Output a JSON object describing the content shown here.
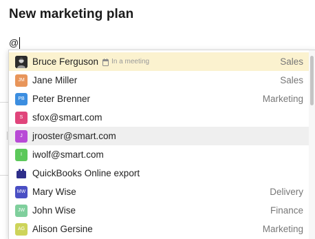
{
  "page": {
    "title": "New marketing plan"
  },
  "editor": {
    "typed_text": "@"
  },
  "mention_list": {
    "items": [
      {
        "name": "Bruce Ferguson",
        "avatar_type": "photo",
        "initials": "",
        "avatar_color": "#2b2b2b",
        "status": "In a meeting",
        "status_icon": "calendar-icon",
        "department": "Sales",
        "state": "highlighted"
      },
      {
        "name": "Jane Miller",
        "avatar_type": "initials",
        "initials": "JM",
        "avatar_color": "#e8955a",
        "status": "",
        "department": "Sales",
        "state": ""
      },
      {
        "name": "Peter Brenner",
        "avatar_type": "initials",
        "initials": "PB",
        "avatar_color": "#3c8ee0",
        "status": "",
        "department": "Marketing",
        "state": ""
      },
      {
        "name": "sfox@smart.com",
        "avatar_type": "initials",
        "initials": "S",
        "avatar_color": "#e0457b",
        "status": "",
        "department": "",
        "state": ""
      },
      {
        "name": "jrooster@smart.com",
        "avatar_type": "initials",
        "initials": "J",
        "avatar_color": "#b84ad6",
        "status": "",
        "department": "",
        "state": "hovered"
      },
      {
        "name": "iwolf@smart.com",
        "avatar_type": "initials",
        "initials": "I",
        "avatar_color": "#5cc85a",
        "status": "",
        "department": "",
        "state": ""
      },
      {
        "name": "QuickBooks Online export",
        "avatar_type": "integration",
        "initials": "",
        "avatar_color": "#2e2f8a",
        "status": "",
        "department": "",
        "state": ""
      },
      {
        "name": "Mary Wise",
        "avatar_type": "initials",
        "initials": "MW",
        "avatar_color": "#4a4fc4",
        "status": "",
        "department": "Delivery",
        "state": ""
      },
      {
        "name": "John Wise",
        "avatar_type": "initials",
        "initials": "JW",
        "avatar_color": "#7fcf9c",
        "status": "",
        "department": "Finance",
        "state": ""
      },
      {
        "name": "Alison Gersine",
        "avatar_type": "initials",
        "initials": "AG",
        "avatar_color": "#cdd45a",
        "status": "",
        "department": "Marketing",
        "state": ""
      }
    ]
  },
  "colors": {
    "highlight": "#fbf2cf",
    "hover": "#efefef",
    "department_text": "#777777"
  }
}
